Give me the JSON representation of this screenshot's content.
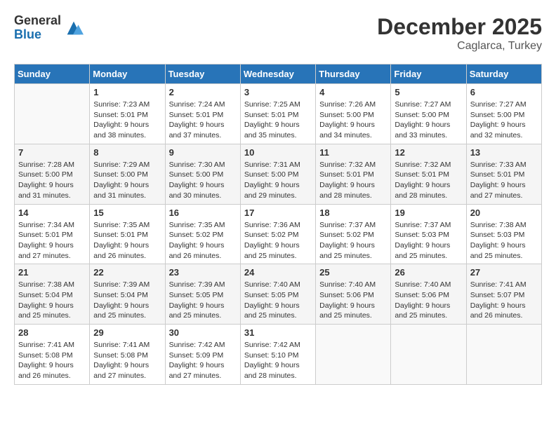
{
  "logo": {
    "general": "General",
    "blue": "Blue"
  },
  "title": "December 2025",
  "location": "Caglarca, Turkey",
  "weekdays": [
    "Sunday",
    "Monday",
    "Tuesday",
    "Wednesday",
    "Thursday",
    "Friday",
    "Saturday"
  ],
  "weeks": [
    [
      {
        "day": "",
        "sunrise": "",
        "sunset": "",
        "daylight": ""
      },
      {
        "day": "1",
        "sunrise": "Sunrise: 7:23 AM",
        "sunset": "Sunset: 5:01 PM",
        "daylight": "Daylight: 9 hours and 38 minutes."
      },
      {
        "day": "2",
        "sunrise": "Sunrise: 7:24 AM",
        "sunset": "Sunset: 5:01 PM",
        "daylight": "Daylight: 9 hours and 37 minutes."
      },
      {
        "day": "3",
        "sunrise": "Sunrise: 7:25 AM",
        "sunset": "Sunset: 5:01 PM",
        "daylight": "Daylight: 9 hours and 35 minutes."
      },
      {
        "day": "4",
        "sunrise": "Sunrise: 7:26 AM",
        "sunset": "Sunset: 5:00 PM",
        "daylight": "Daylight: 9 hours and 34 minutes."
      },
      {
        "day": "5",
        "sunrise": "Sunrise: 7:27 AM",
        "sunset": "Sunset: 5:00 PM",
        "daylight": "Daylight: 9 hours and 33 minutes."
      },
      {
        "day": "6",
        "sunrise": "Sunrise: 7:27 AM",
        "sunset": "Sunset: 5:00 PM",
        "daylight": "Daylight: 9 hours and 32 minutes."
      }
    ],
    [
      {
        "day": "7",
        "sunrise": "Sunrise: 7:28 AM",
        "sunset": "Sunset: 5:00 PM",
        "daylight": "Daylight: 9 hours and 31 minutes."
      },
      {
        "day": "8",
        "sunrise": "Sunrise: 7:29 AM",
        "sunset": "Sunset: 5:00 PM",
        "daylight": "Daylight: 9 hours and 31 minutes."
      },
      {
        "day": "9",
        "sunrise": "Sunrise: 7:30 AM",
        "sunset": "Sunset: 5:00 PM",
        "daylight": "Daylight: 9 hours and 30 minutes."
      },
      {
        "day": "10",
        "sunrise": "Sunrise: 7:31 AM",
        "sunset": "Sunset: 5:00 PM",
        "daylight": "Daylight: 9 hours and 29 minutes."
      },
      {
        "day": "11",
        "sunrise": "Sunrise: 7:32 AM",
        "sunset": "Sunset: 5:01 PM",
        "daylight": "Daylight: 9 hours and 28 minutes."
      },
      {
        "day": "12",
        "sunrise": "Sunrise: 7:32 AM",
        "sunset": "Sunset: 5:01 PM",
        "daylight": "Daylight: 9 hours and 28 minutes."
      },
      {
        "day": "13",
        "sunrise": "Sunrise: 7:33 AM",
        "sunset": "Sunset: 5:01 PM",
        "daylight": "Daylight: 9 hours and 27 minutes."
      }
    ],
    [
      {
        "day": "14",
        "sunrise": "Sunrise: 7:34 AM",
        "sunset": "Sunset: 5:01 PM",
        "daylight": "Daylight: 9 hours and 27 minutes."
      },
      {
        "day": "15",
        "sunrise": "Sunrise: 7:35 AM",
        "sunset": "Sunset: 5:01 PM",
        "daylight": "Daylight: 9 hours and 26 minutes."
      },
      {
        "day": "16",
        "sunrise": "Sunrise: 7:35 AM",
        "sunset": "Sunset: 5:02 PM",
        "daylight": "Daylight: 9 hours and 26 minutes."
      },
      {
        "day": "17",
        "sunrise": "Sunrise: 7:36 AM",
        "sunset": "Sunset: 5:02 PM",
        "daylight": "Daylight: 9 hours and 25 minutes."
      },
      {
        "day": "18",
        "sunrise": "Sunrise: 7:37 AM",
        "sunset": "Sunset: 5:02 PM",
        "daylight": "Daylight: 9 hours and 25 minutes."
      },
      {
        "day": "19",
        "sunrise": "Sunrise: 7:37 AM",
        "sunset": "Sunset: 5:03 PM",
        "daylight": "Daylight: 9 hours and 25 minutes."
      },
      {
        "day": "20",
        "sunrise": "Sunrise: 7:38 AM",
        "sunset": "Sunset: 5:03 PM",
        "daylight": "Daylight: 9 hours and 25 minutes."
      }
    ],
    [
      {
        "day": "21",
        "sunrise": "Sunrise: 7:38 AM",
        "sunset": "Sunset: 5:04 PM",
        "daylight": "Daylight: 9 hours and 25 minutes."
      },
      {
        "day": "22",
        "sunrise": "Sunrise: 7:39 AM",
        "sunset": "Sunset: 5:04 PM",
        "daylight": "Daylight: 9 hours and 25 minutes."
      },
      {
        "day": "23",
        "sunrise": "Sunrise: 7:39 AM",
        "sunset": "Sunset: 5:05 PM",
        "daylight": "Daylight: 9 hours and 25 minutes."
      },
      {
        "day": "24",
        "sunrise": "Sunrise: 7:40 AM",
        "sunset": "Sunset: 5:05 PM",
        "daylight": "Daylight: 9 hours and 25 minutes."
      },
      {
        "day": "25",
        "sunrise": "Sunrise: 7:40 AM",
        "sunset": "Sunset: 5:06 PM",
        "daylight": "Daylight: 9 hours and 25 minutes."
      },
      {
        "day": "26",
        "sunrise": "Sunrise: 7:40 AM",
        "sunset": "Sunset: 5:06 PM",
        "daylight": "Daylight: 9 hours and 25 minutes."
      },
      {
        "day": "27",
        "sunrise": "Sunrise: 7:41 AM",
        "sunset": "Sunset: 5:07 PM",
        "daylight": "Daylight: 9 hours and 26 minutes."
      }
    ],
    [
      {
        "day": "28",
        "sunrise": "Sunrise: 7:41 AM",
        "sunset": "Sunset: 5:08 PM",
        "daylight": "Daylight: 9 hours and 26 minutes."
      },
      {
        "day": "29",
        "sunrise": "Sunrise: 7:41 AM",
        "sunset": "Sunset: 5:08 PM",
        "daylight": "Daylight: 9 hours and 27 minutes."
      },
      {
        "day": "30",
        "sunrise": "Sunrise: 7:42 AM",
        "sunset": "Sunset: 5:09 PM",
        "daylight": "Daylight: 9 hours and 27 minutes."
      },
      {
        "day": "31",
        "sunrise": "Sunrise: 7:42 AM",
        "sunset": "Sunset: 5:10 PM",
        "daylight": "Daylight: 9 hours and 28 minutes."
      },
      {
        "day": "",
        "sunrise": "",
        "sunset": "",
        "daylight": ""
      },
      {
        "day": "",
        "sunrise": "",
        "sunset": "",
        "daylight": ""
      },
      {
        "day": "",
        "sunrise": "",
        "sunset": "",
        "daylight": ""
      }
    ]
  ]
}
